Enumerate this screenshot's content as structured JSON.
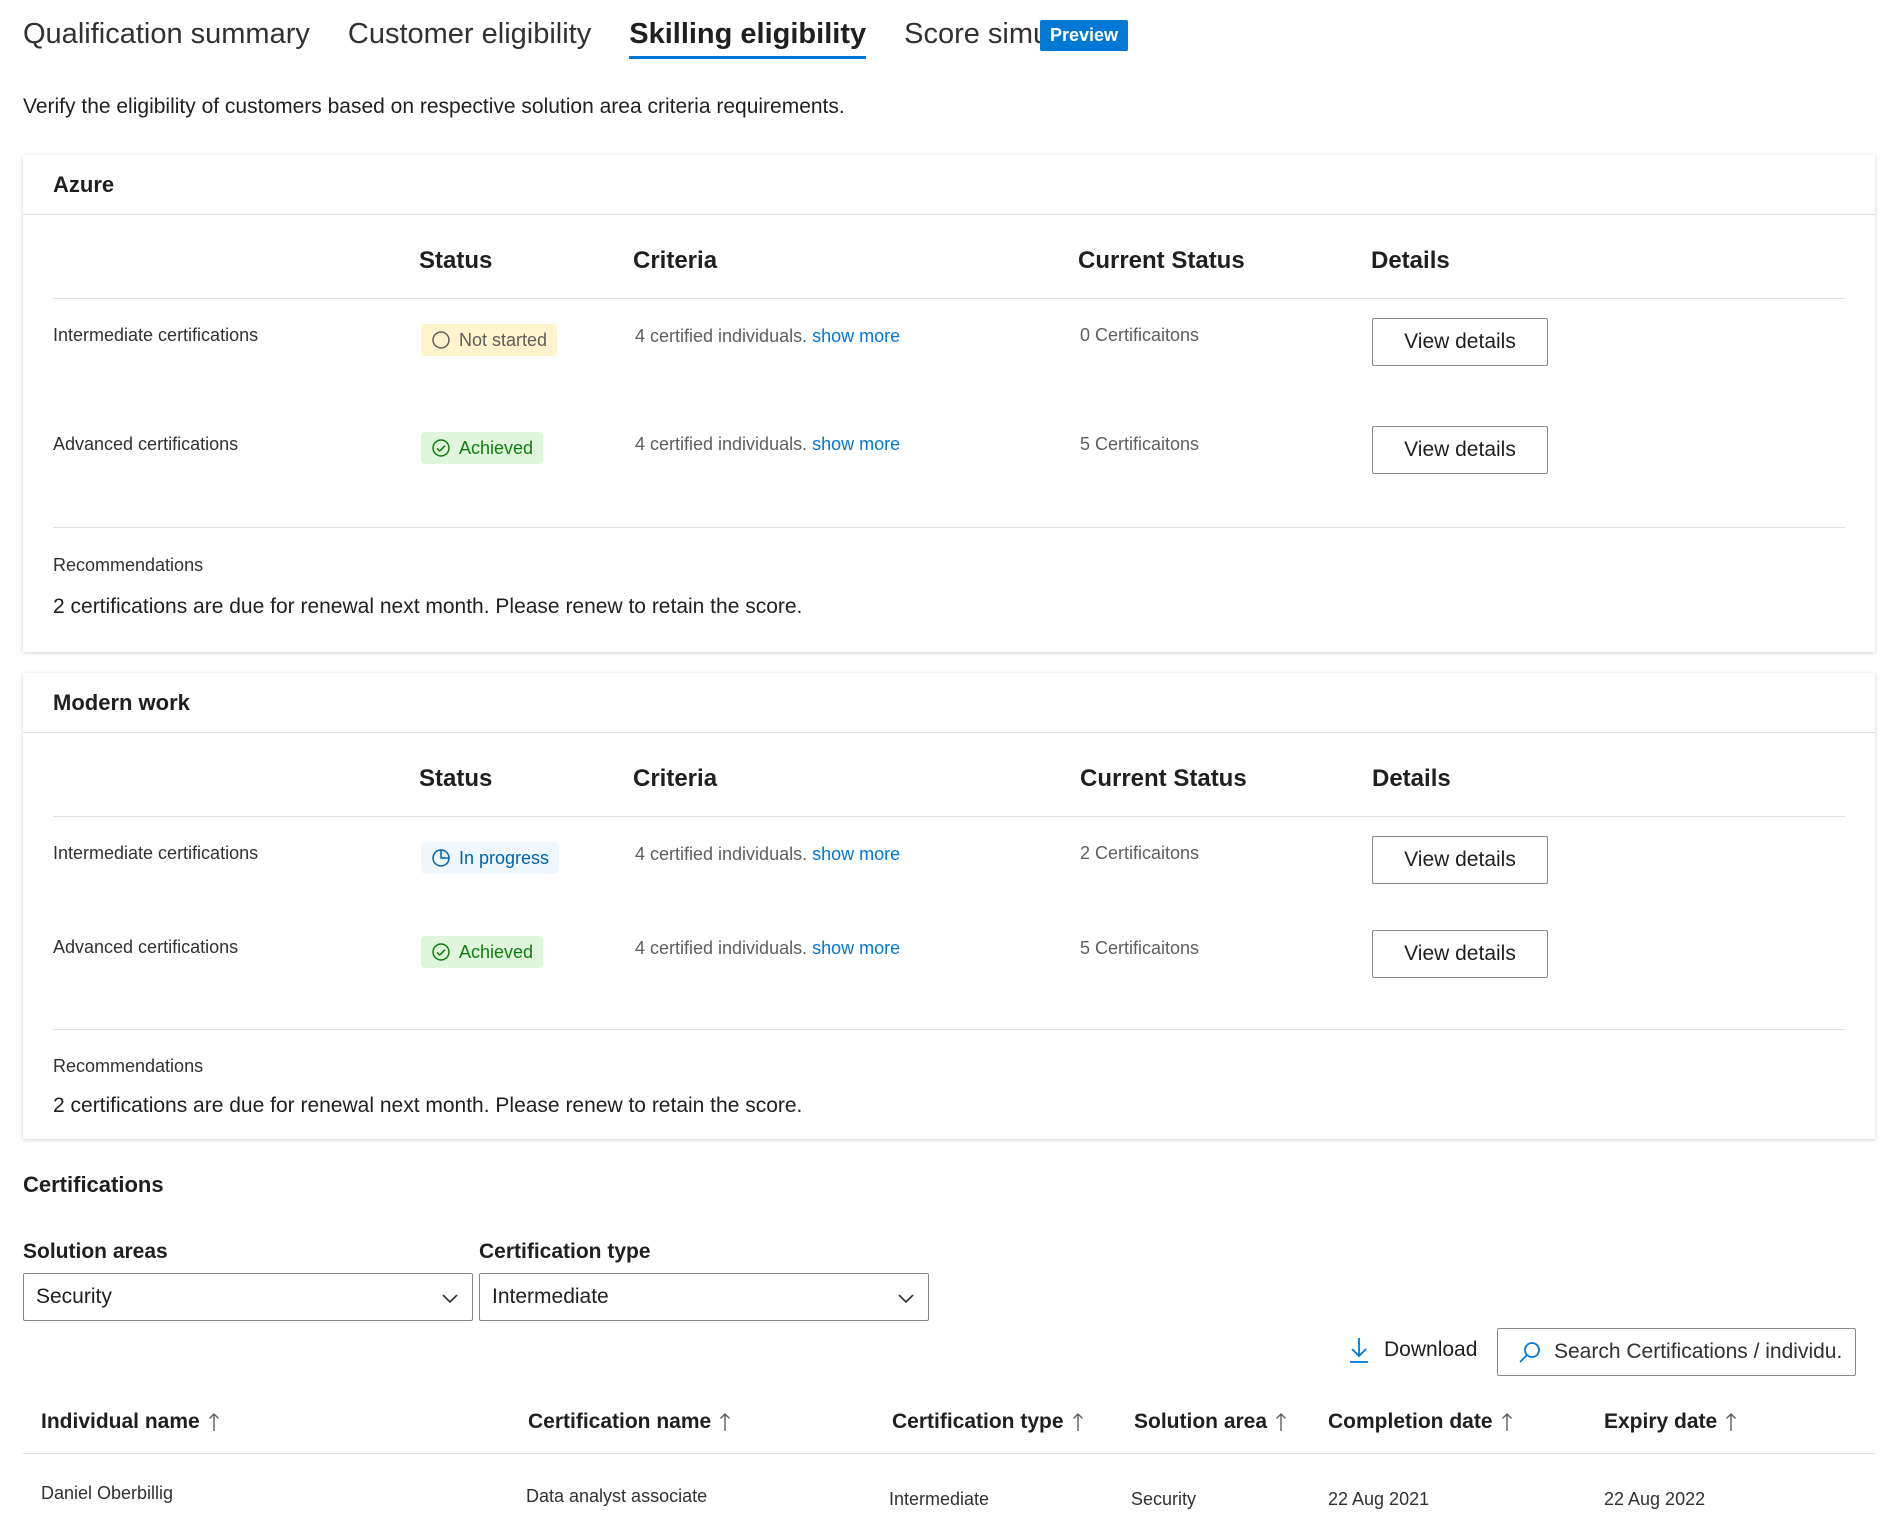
{
  "tabs": [
    {
      "label": "Qualification summary"
    },
    {
      "label": "Customer eligibility"
    },
    {
      "label": "Skilling eligibility"
    },
    {
      "label": "Score simulator"
    }
  ],
  "preview_badge": "Preview",
  "intro": "Verify the eligibility of customers based on respective solution area criteria requirements.",
  "columns": {
    "status": "Status",
    "criteria": "Criteria",
    "current_status": "Current Status",
    "details": "Details"
  },
  "azure": {
    "title": "Azure",
    "rows": [
      {
        "label": "Intermediate certifications",
        "status": "Not started",
        "criteria": "4 certified individuals.",
        "criteria_link": "show more",
        "current": "0 Certificaitons",
        "button": "View details"
      },
      {
        "label": "Advanced certifications",
        "status": "Achieved",
        "criteria": "4 certified individuals.",
        "criteria_link": "show more",
        "current": "5 Certificaitons",
        "button": "View details"
      }
    ],
    "rec_label": "Recommendations",
    "rec_text": "2 certifications are due for renewal next month. Please renew to retain the score."
  },
  "modern_work": {
    "title": "Modern work",
    "rows": [
      {
        "label": "Intermediate certifications",
        "status": "In progress",
        "criteria": "4 certified individuals.",
        "criteria_link": "show more",
        "current": "2 Certificaitons",
        "button": "View details"
      },
      {
        "label": "Advanced certifications",
        "status": "Achieved",
        "criteria": "4 certified individuals.",
        "criteria_link": "show more",
        "current": "5 Certificaitons",
        "button": "View details"
      }
    ],
    "rec_label": "Recommendations",
    "rec_text": "2 certifications are due for renewal next month. Please renew to retain the score."
  },
  "certifications": {
    "title": "Certifications",
    "solution_areas_label": "Solution areas",
    "solution_areas_value": "Security",
    "cert_type_label": "Certification type",
    "cert_type_value": "Intermediate",
    "download_label": "Download",
    "search_placeholder": "Search Certifications / individu.",
    "headers": [
      "Individual name",
      "Certification name",
      "Certification type",
      "Solution area",
      "Completion date",
      "Expiry date"
    ],
    "rows": [
      [
        "Daniel Oberbillig",
        "Data analyst associate",
        "Intermediate",
        "Security",
        "22 Aug 2021",
        "22 Aug 2022"
      ]
    ]
  },
  "colors": {
    "accent": "#0078d4",
    "success": "#107c10",
    "warning_bg": "#fff4ce"
  }
}
